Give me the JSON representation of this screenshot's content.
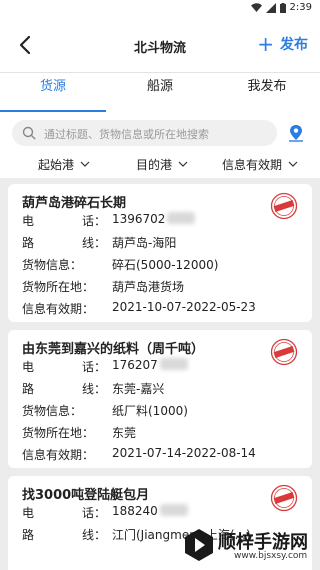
{
  "status_bar": {
    "time": "2:39"
  },
  "header": {
    "title": "北斗物流",
    "publish_label": "发布"
  },
  "tabs": [
    {
      "label": "货源",
      "active": true
    },
    {
      "label": "船源",
      "active": false
    },
    {
      "label": "我发布",
      "active": false
    }
  ],
  "search": {
    "placeholder": "通过标题、货物信息或所在地搜索"
  },
  "filters": [
    {
      "label": "起始港"
    },
    {
      "label": "目的港"
    },
    {
      "label": "信息有效期"
    }
  ],
  "field_labels": {
    "phone": [
      "电",
      "话："
    ],
    "route": [
      "路",
      "线："
    ],
    "cargo": [
      "货物信息：",
      ""
    ],
    "location": [
      "货物所在地：",
      ""
    ],
    "valid": [
      "信息有效期：",
      ""
    ]
  },
  "listings": [
    {
      "title": "葫芦岛港碎石长期",
      "phone": "1396702",
      "route": "葫芦岛-海阳",
      "cargo": "碎石(5000-12000)",
      "location": "葫芦岛港货场",
      "valid": "2021-10-07-2022-05-23"
    },
    {
      "title": "由东莞到嘉兴的纸料（周千吨）",
      "phone": "176207",
      "route": "东莞-嘉兴",
      "cargo": "纸厂料(1000)",
      "location": "东莞",
      "valid": "2021-07-14-2022-08-14"
    },
    {
      "title": "找3000吨登陆艇包月",
      "phone": "188240",
      "route": "江门(Jiangmen)-上海(...)"
    }
  ],
  "watermark": {
    "name": "顺梓手游网",
    "url": "www.bjsxsy.com"
  },
  "colors": {
    "accent": "#2b7de1",
    "stamp": "#d93a3a"
  }
}
